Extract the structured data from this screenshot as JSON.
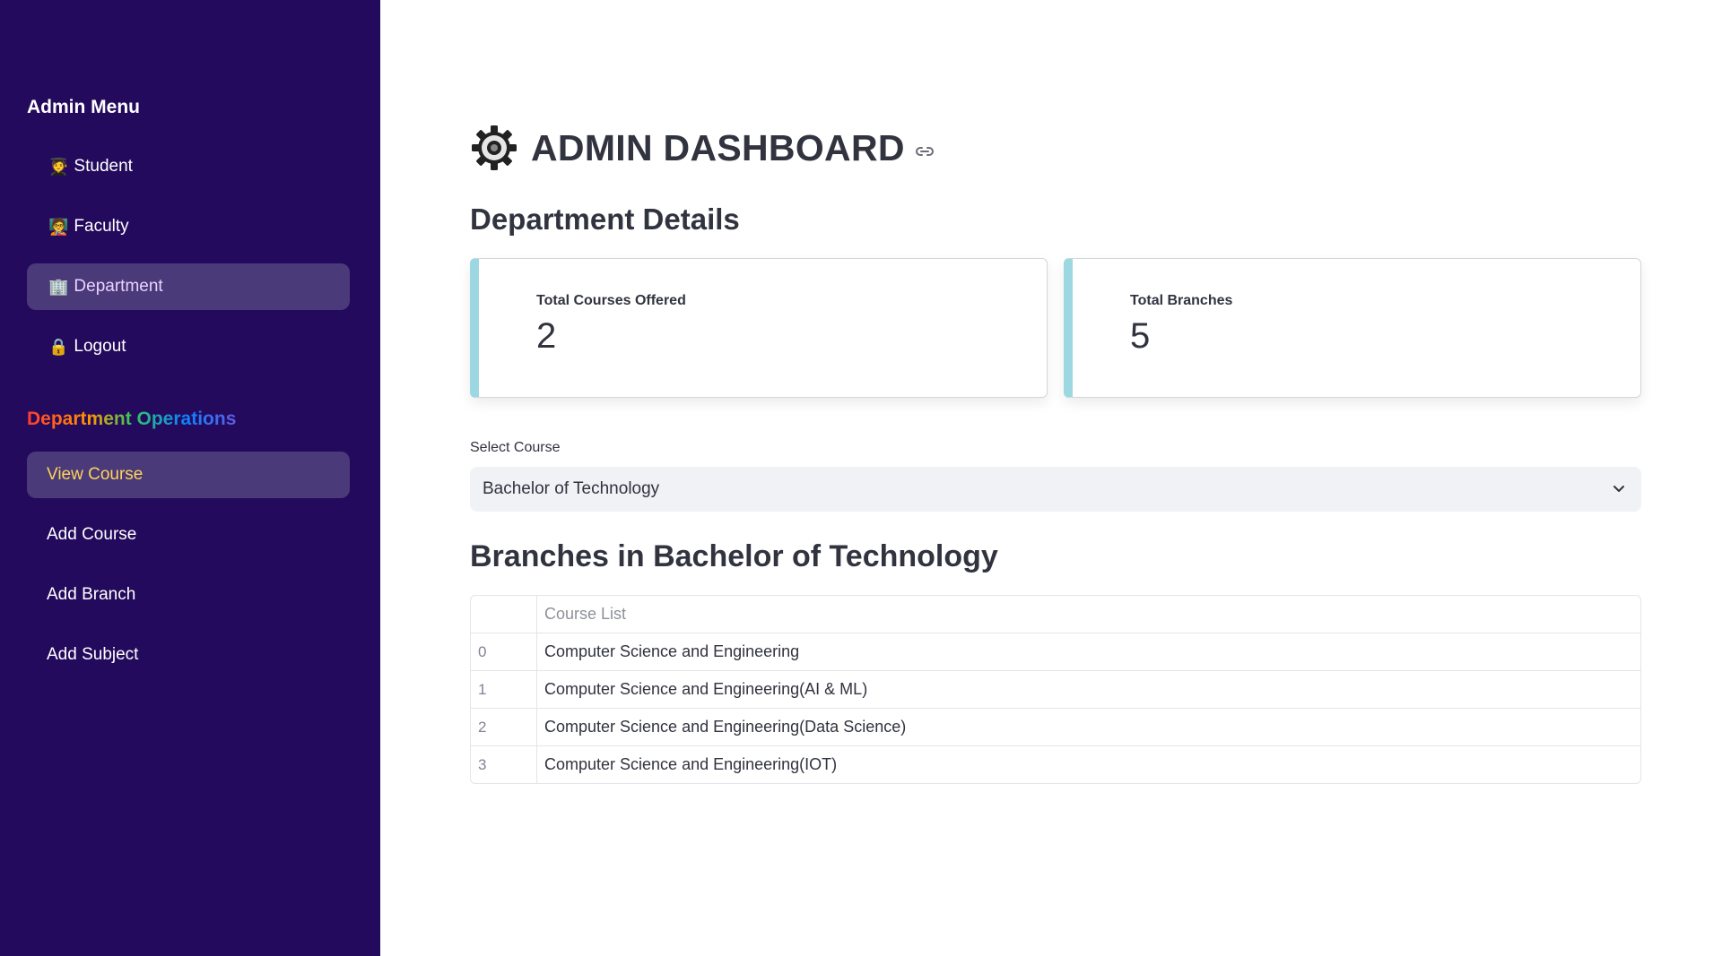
{
  "sidebar": {
    "menu_title": "Admin Menu",
    "items": [
      {
        "emoji": "🧑‍🎓",
        "label": "Student"
      },
      {
        "emoji": "🧑‍🏫",
        "label": "Faculty"
      },
      {
        "emoji": "🏢",
        "label": "Department"
      },
      {
        "emoji": "🔒",
        "label": "Logout"
      }
    ],
    "active_item": "Department",
    "ops_title": "Department Operations",
    "operations": [
      "View Course",
      "Add Course",
      "Add Branch",
      "Add Subject"
    ],
    "active_operation": "View Course"
  },
  "main": {
    "title": "ADMIN DASHBOARD",
    "section_title": "Department Details",
    "cards": [
      {
        "label": "Total Courses Offered",
        "value": "2"
      },
      {
        "label": "Total Branches",
        "value": "5"
      }
    ],
    "select_label": "Select Course",
    "selected_course": "Bachelor of Technology",
    "branches_title": "Branches in Bachelor of Technology",
    "table": {
      "header": [
        "",
        "Course List"
      ],
      "rows": [
        [
          "0",
          "Computer Science and Engineering"
        ],
        [
          "1",
          "Computer Science and Engineering(AI & ML)"
        ],
        [
          "2",
          "Computer Science and Engineering(Data Science)"
        ],
        [
          "3",
          "Computer Science and Engineering(IOT)"
        ]
      ]
    }
  },
  "colors": {
    "sidebar_bg": "#240a5c",
    "active_bg": "#4a3a79",
    "active_operation_text": "#ffd35a",
    "card_accent": "#9dd7e2"
  },
  "icons": {
    "title_icon": "gear-icon",
    "anchor_icon": "link-icon",
    "select_icon": "chevron-down-icon"
  }
}
